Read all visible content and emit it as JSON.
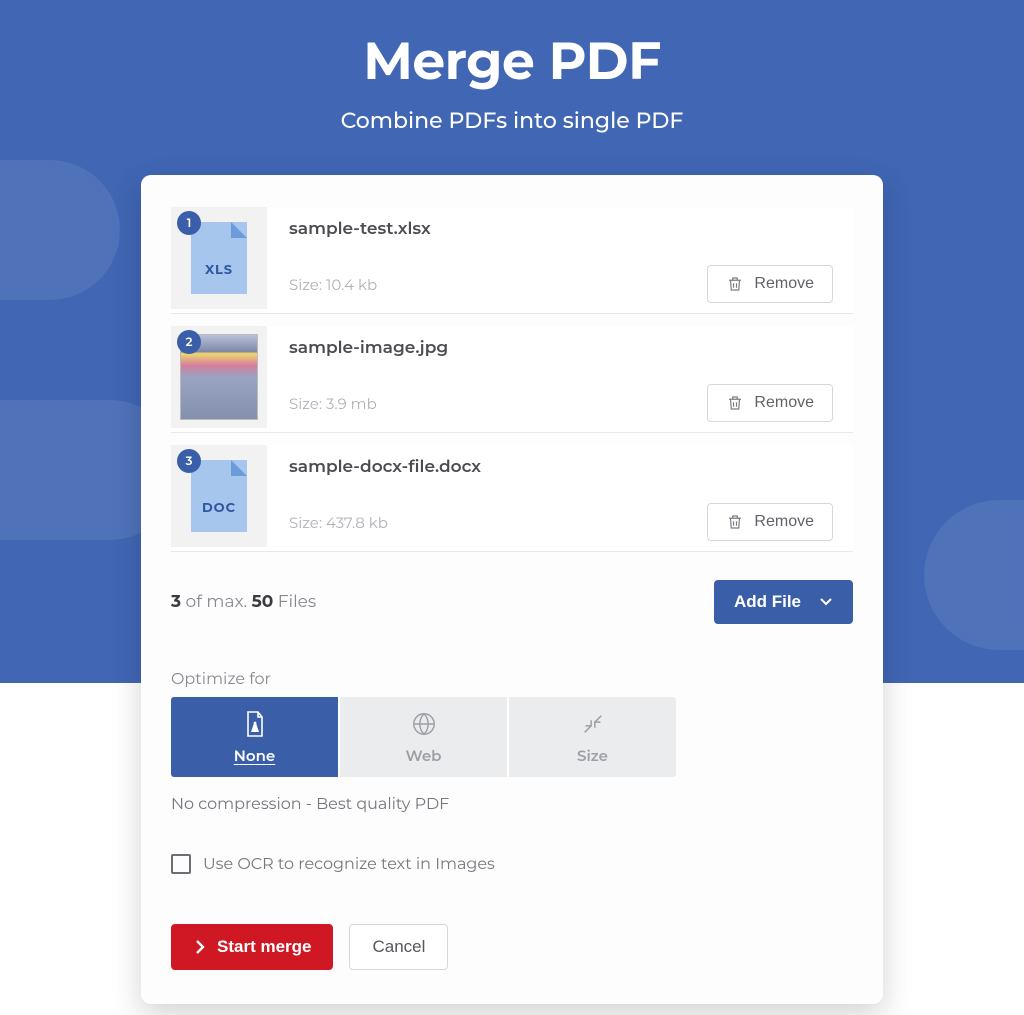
{
  "header": {
    "title": "Merge PDF",
    "subtitle": "Combine PDFs into single PDF"
  },
  "files": [
    {
      "index": "1",
      "name": "sample-test.xlsx",
      "size_prefix": "Size: ",
      "size": "10.4 kb",
      "ext": "XLS",
      "type": "doc"
    },
    {
      "index": "2",
      "name": "sample-image.jpg",
      "size_prefix": "Size: ",
      "size": "3.9 mb",
      "ext": "",
      "type": "image"
    },
    {
      "index": "3",
      "name": "sample-docx-file.docx",
      "size_prefix": "Size: ",
      "size": "437.8 kb",
      "ext": "DOC",
      "type": "doc"
    }
  ],
  "labels": {
    "remove": "Remove",
    "add_file": "Add File",
    "optimize_for": "Optimize for",
    "optimize_none": "None",
    "optimize_web": "Web",
    "optimize_size": "Size",
    "optimize_description": "No compression - Best quality PDF",
    "ocr": "Use OCR to recognize text in Images",
    "start": "Start merge",
    "cancel": "Cancel"
  },
  "counter": {
    "count": "3",
    "mid": " of max. ",
    "max": "50",
    "suffix": " Files"
  }
}
